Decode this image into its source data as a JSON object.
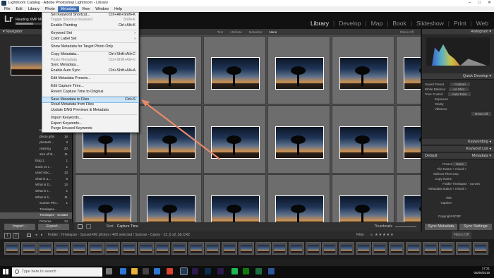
{
  "window": {
    "title": "Lightroom Catalog - Adobe Photoshop Lightroom - Library",
    "controls": [
      "–",
      "□",
      "✕"
    ]
  },
  "menubar": [
    "File",
    "Edit",
    "Library",
    "Photo",
    "Metadata",
    "View",
    "Window",
    "Help"
  ],
  "identity": {
    "logo": "Lr",
    "status": "Reading XMP Metadata",
    "progress": 0.55,
    "modules": [
      "Library",
      "Develop",
      "Map",
      "Book",
      "Slideshow",
      "Print",
      "Web"
    ],
    "active_module": "Library"
  },
  "left_panel": {
    "navigator_label": "Navigator",
    "folders": [
      {
        "name": "NO FINISH...",
        "count": "37"
      },
      {
        "name": "photo gifts",
        "count": "18"
      },
      {
        "name": "photosh...",
        "count": "3"
      },
      {
        "name": "resizing",
        "count": "20"
      },
      {
        "name": "size of th...",
        "count": "11"
      },
      {
        "name": "blog 1",
        "count": "1"
      },
      {
        "name": "stock vs r...",
        "count": "1"
      },
      {
        "name": "used stoc...",
        "count": "13"
      },
      {
        "name": "what is a...",
        "count": "8"
      },
      {
        "name": "What is D...",
        "count": "13"
      },
      {
        "name": "What is I...",
        "count": "1"
      },
      {
        "name": "What is li...",
        "count": "11"
      },
      {
        "name": "Sunset Pho...",
        "count": "1"
      },
      {
        "name": "Timelapse...",
        "count": ""
      },
      {
        "name": "Timelapse - Sun...",
        "count": "400"
      },
      {
        "name": "Pictures",
        "count": "14"
      },
      {
        "name": "2019",
        "count": "0"
      }
    ],
    "import_label": "Import...",
    "export_label": "Export..."
  },
  "filter_bar": [
    "Text",
    "Attribute",
    "Metadata",
    "None"
  ],
  "filter_status": "Filters Off",
  "toolbar": {
    "sort_label": "Sort:",
    "sort_value": "Capture Time",
    "thumbnails_label": "Thumbnails"
  },
  "right_panel": {
    "histogram_label": "Histogram",
    "quick_develop_label": "Quick Develop",
    "saved_preset_label": "Saved Preset",
    "saved_preset_value": "Custom",
    "white_balance_label": "White Balance",
    "white_balance_value": "As Shot",
    "tone_control_label": "Tone Control",
    "tone_control_value": "Auto Tone",
    "exposure_label": "Exposure",
    "clarity_label": "Clarity",
    "vibrance_label": "Vibrance",
    "reset_all_label": "Reset All",
    "keywording_label": "Keywording",
    "keyword_list_label": "Keyword List",
    "metadata_label": "Metadata",
    "metadata_default": "Default",
    "preset_label": "Preset",
    "preset_value": "None",
    "file_name_label": "File Name",
    "file_name_value": "< mixed >",
    "sidecar_label": "Sidecar Files",
    "sidecar_value": "xmp",
    "copy_name_label": "Copy Name",
    "folder_label": "Folder",
    "folder_value": "Timelapse - Sunset",
    "status_label": "Metadata Status",
    "status_value": "< mixed >",
    "title_label": "Title",
    "caption_label": "Caption",
    "copyright_label": "Copyright",
    "copyright_value": "BCBF",
    "sync_metadata": "Sync Metadata",
    "sync_settings": "Sync Settings"
  },
  "filmstrip_header": {
    "views": [
      "1",
      "2"
    ],
    "folder_path": "Folder : Timelapse - Sunset",
    "count_text": "400 photos / 400 selected / Sunrise - Casey - 13_6 x2_bb.CR2",
    "filter_label": "Filter :",
    "filter_value": "Filters Off"
  },
  "metadata_menu": {
    "items": [
      {
        "label": "Set Keyword Shortcut...",
        "shortcut": "Ctrl+Alt+Shift+K",
        "disabled": false
      },
      {
        "label": "Toggle Shortcut Keyword",
        "shortcut": "Shift+K",
        "disabled": true
      },
      {
        "label": "Enable Painting",
        "shortcut": "Ctrl+Alt+K",
        "disabled": false
      },
      {
        "sep": true
      },
      {
        "label": "Keyword Set",
        "shortcut": "›",
        "disabled": false
      },
      {
        "label": "Color Label Set",
        "shortcut": "›",
        "disabled": false
      },
      {
        "sep": true
      },
      {
        "label": "Show Metadata for Target Photo Only",
        "shortcut": "",
        "disabled": false
      },
      {
        "sep": true
      },
      {
        "label": "Copy Metadata...",
        "shortcut": "Ctrl+Shift+Alt+C",
        "disabled": false
      },
      {
        "label": "Paste Metadata",
        "shortcut": "Ctrl+Shift+Alt+V",
        "disabled": true
      },
      {
        "label": "Sync Metadata...",
        "shortcut": "",
        "disabled": false
      },
      {
        "label": "Enable Auto Sync",
        "shortcut": "Ctrl+Shift+Alt+A",
        "disabled": false
      },
      {
        "sep": true
      },
      {
        "label": "Edit Metadata Presets...",
        "shortcut": "",
        "disabled": false
      },
      {
        "sep": true
      },
      {
        "label": "Edit Capture Time...",
        "shortcut": "",
        "disabled": false
      },
      {
        "label": "Revert Capture Time to Original",
        "shortcut": "",
        "disabled": false
      },
      {
        "sep": true
      },
      {
        "label": "Save Metadata to Files",
        "shortcut": "Ctrl+S",
        "disabled": false,
        "highlight": true
      },
      {
        "label": "Read Metadata from Files",
        "shortcut": "",
        "disabled": false
      },
      {
        "label": "Update DNG Previews & Metadata",
        "shortcut": "",
        "disabled": false
      },
      {
        "sep": true
      },
      {
        "label": "Import Keywords...",
        "shortcut": "",
        "disabled": false
      },
      {
        "label": "Export Keywords...",
        "shortcut": "",
        "disabled": false
      },
      {
        "label": "Purge Unused Keywords",
        "shortcut": "",
        "disabled": false
      }
    ]
  },
  "taskbar": {
    "search_placeholder": "Type here to search",
    "time": "17:21",
    "date": "05/06/2018"
  },
  "colors": {
    "annotation_arrow": "#e88a6a",
    "menu_highlight": "#cce4f7",
    "accent": "#3d6fb5"
  }
}
